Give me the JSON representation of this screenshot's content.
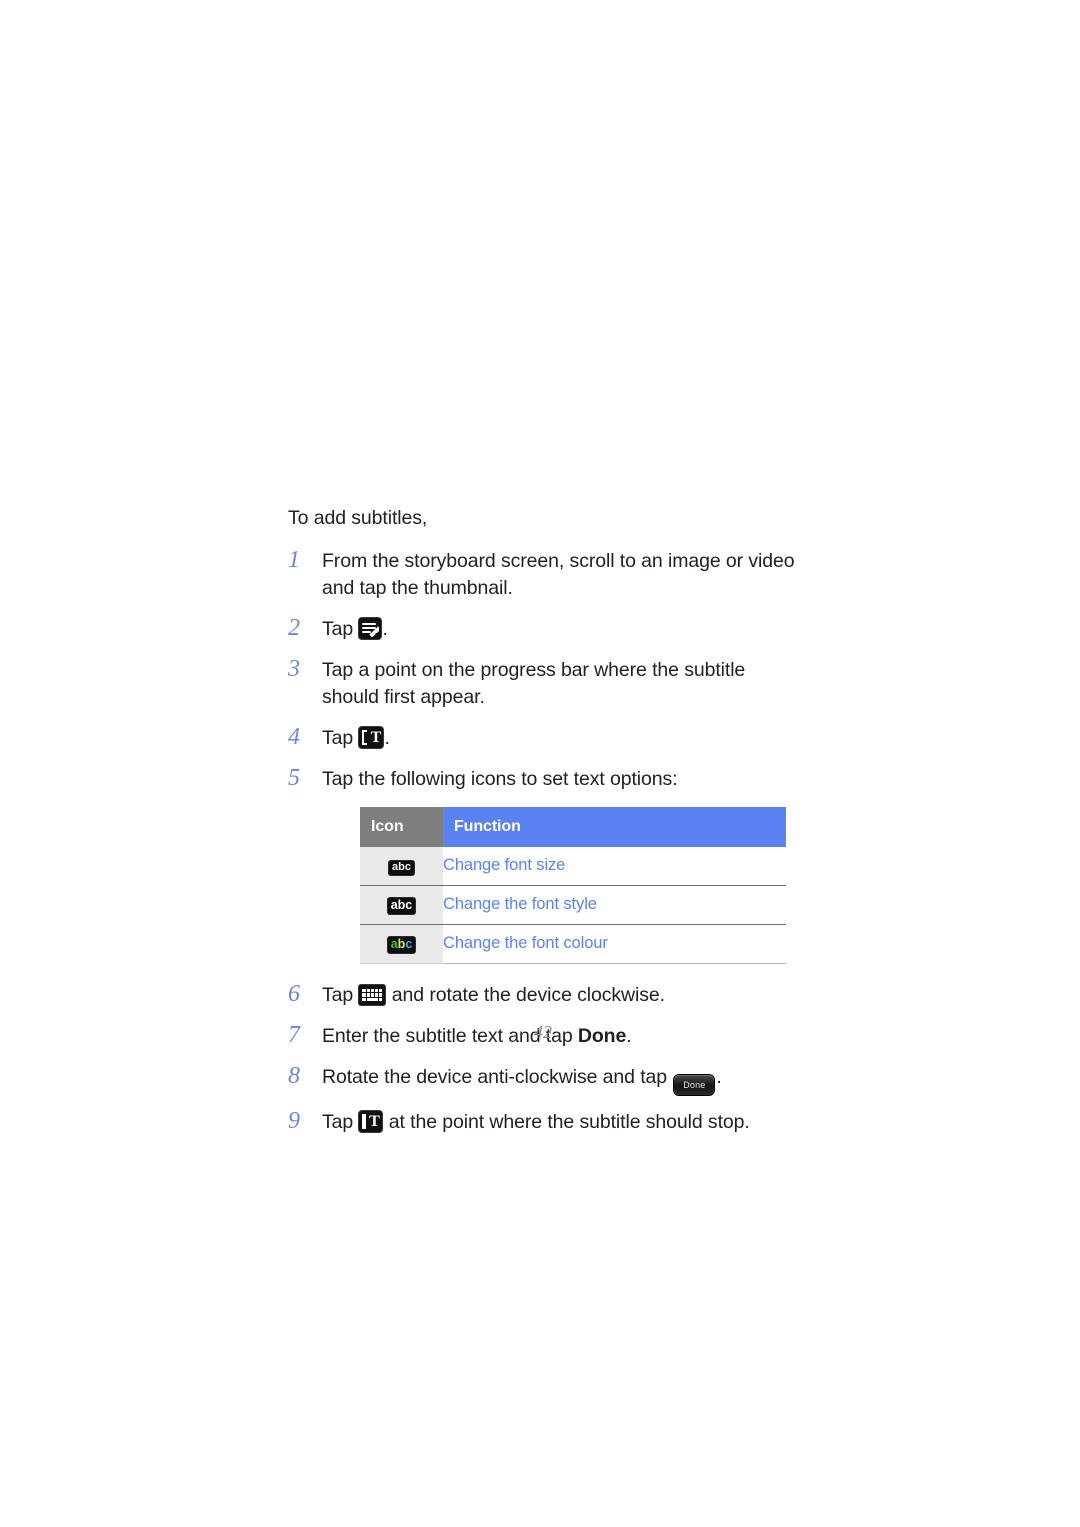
{
  "page": {
    "intro": "To add subtitles,",
    "folio": "42"
  },
  "steps": [
    {
      "num": "1",
      "icon": null,
      "text_before": "From the storyboard screen, scroll to an image or video and tap the thumbnail.",
      "text_after": ""
    },
    {
      "num": "2",
      "icon": "edit-note-icon",
      "text_before": "Tap ",
      "text_after": "."
    },
    {
      "num": "3",
      "icon": null,
      "text_before": "Tap a point on the progress bar where the subtitle should first appear.",
      "text_after": ""
    },
    {
      "num": "4",
      "icon": "bracket-text-start-icon",
      "text_before": "Tap ",
      "text_after": "."
    },
    {
      "num": "5",
      "icon": null,
      "text_before": "Tap the following icons to set text options:",
      "text_after": ""
    },
    {
      "num": "6",
      "icon": "keyboard-icon",
      "text_before": "Tap ",
      "text_after": " and rotate the device clockwise."
    },
    {
      "num": "7",
      "icon": null,
      "text_before": "Enter the subtitle text and tap ",
      "bold": "Done",
      "text_after": "."
    },
    {
      "num": "8",
      "icon": "done-button-icon",
      "text_before": "Rotate the device anti-clockwise and tap ",
      "text_after": "."
    },
    {
      "num": "9",
      "icon": "text-end-icon",
      "text_before": "Tap ",
      "text_after": " at the point where the subtitle should stop."
    }
  ],
  "table": {
    "headers": {
      "icon": "Icon",
      "function": "Function"
    },
    "rows": [
      {
        "icon_name": "abc-font-size-icon",
        "icon_text": "abc",
        "function": "Change font size"
      },
      {
        "icon_name": "abc-font-style-icon",
        "icon_text": "abc",
        "function": "Change the font style"
      },
      {
        "icon_name": "abc-font-colour-icon",
        "icon_a": "a",
        "icon_b": "b",
        "icon_c": "c",
        "function": "Change the font colour"
      }
    ]
  },
  "buttons": {
    "done_pill_label": "Done"
  },
  "colors": {
    "step_number": "#6f85d8",
    "link_blue": "#5b82f2",
    "header_gray": "#7e7e7e",
    "icon_cell_bg": "#e9e9e9",
    "font_colour_green": "#36c437",
    "font_colour_yellow": "#f2e53c",
    "font_colour_blue": "#4ea8ff"
  }
}
